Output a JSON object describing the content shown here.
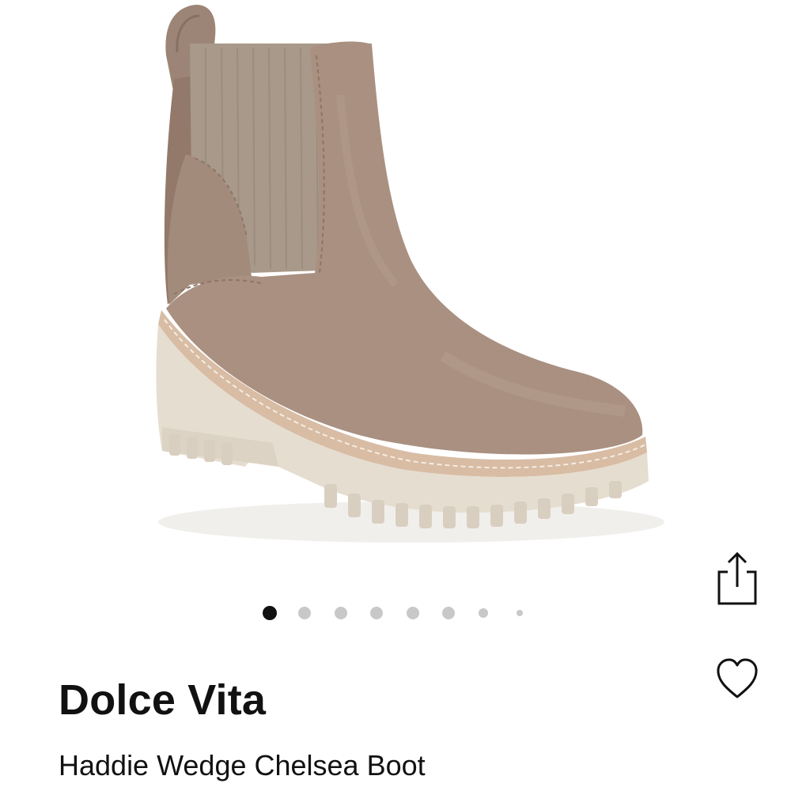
{
  "product": {
    "brand": "Dolce Vita",
    "name": "Haddie Wedge Chelsea Boot"
  },
  "gallery": {
    "image_subject": "taupe suede chelsea boot",
    "image_count": 8,
    "active_index": 0
  },
  "actions": {
    "share_icon": "share-icon",
    "favorite_icon": "heart-icon"
  },
  "colors": {
    "text": "#111111",
    "dot_active": "#111111",
    "dot_inactive": "#c8c8c8",
    "suede": "#a88f80",
    "sole": "#e5ddd0",
    "welt": "#d8bca4"
  }
}
